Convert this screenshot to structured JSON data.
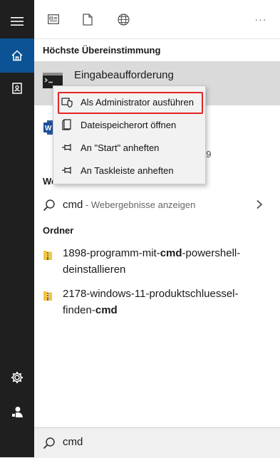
{
  "sidebar": {
    "items": [
      {
        "name": "hamburger-menu-icon"
      },
      {
        "name": "home-icon"
      },
      {
        "name": "documents-icon"
      },
      {
        "name": "settings-icon"
      },
      {
        "name": "user-icon"
      }
    ]
  },
  "topbar": {
    "icons": [
      "apps-icon",
      "document-icon",
      "web-icon"
    ],
    "more": "···"
  },
  "best_match": {
    "heading": "Höchste Übereinstimmung",
    "title": "Eingabeaufforderung"
  },
  "partially_hidden": {
    "web_heading_fragment": "We",
    "date_fragment": "29"
  },
  "context_menu": {
    "items": [
      {
        "label": "Als Administrator ausführen",
        "icon": "shield-icon"
      },
      {
        "label": "Dateispeicherort öffnen",
        "icon": "file-location-icon"
      },
      {
        "label": "An \"Start\" anheften",
        "icon": "pin-icon"
      },
      {
        "label": "An Taskleiste anheften",
        "icon": "pin-icon"
      }
    ]
  },
  "web_result": {
    "query": "cmd",
    "suffix": " - Webergebnisse anzeigen"
  },
  "folders": {
    "heading": "Ordner",
    "items": [
      {
        "line1_pre": "1898-programm-mit-",
        "line1_bold": "cmd",
        "line1_post": "-powershell-",
        "line2": "deinstallieren"
      },
      {
        "line1_pre": "2178-windows-11-produktschluessel-",
        "line1_bold": "",
        "line1_post": "",
        "line2_pre": "finden-",
        "line2_bold": "cmd"
      }
    ]
  },
  "search": {
    "value": "cmd"
  },
  "colors": {
    "sidebar_bg": "#1f1f1f",
    "sidebar_active": "#0b5394",
    "highlight_border": "#e32424"
  }
}
